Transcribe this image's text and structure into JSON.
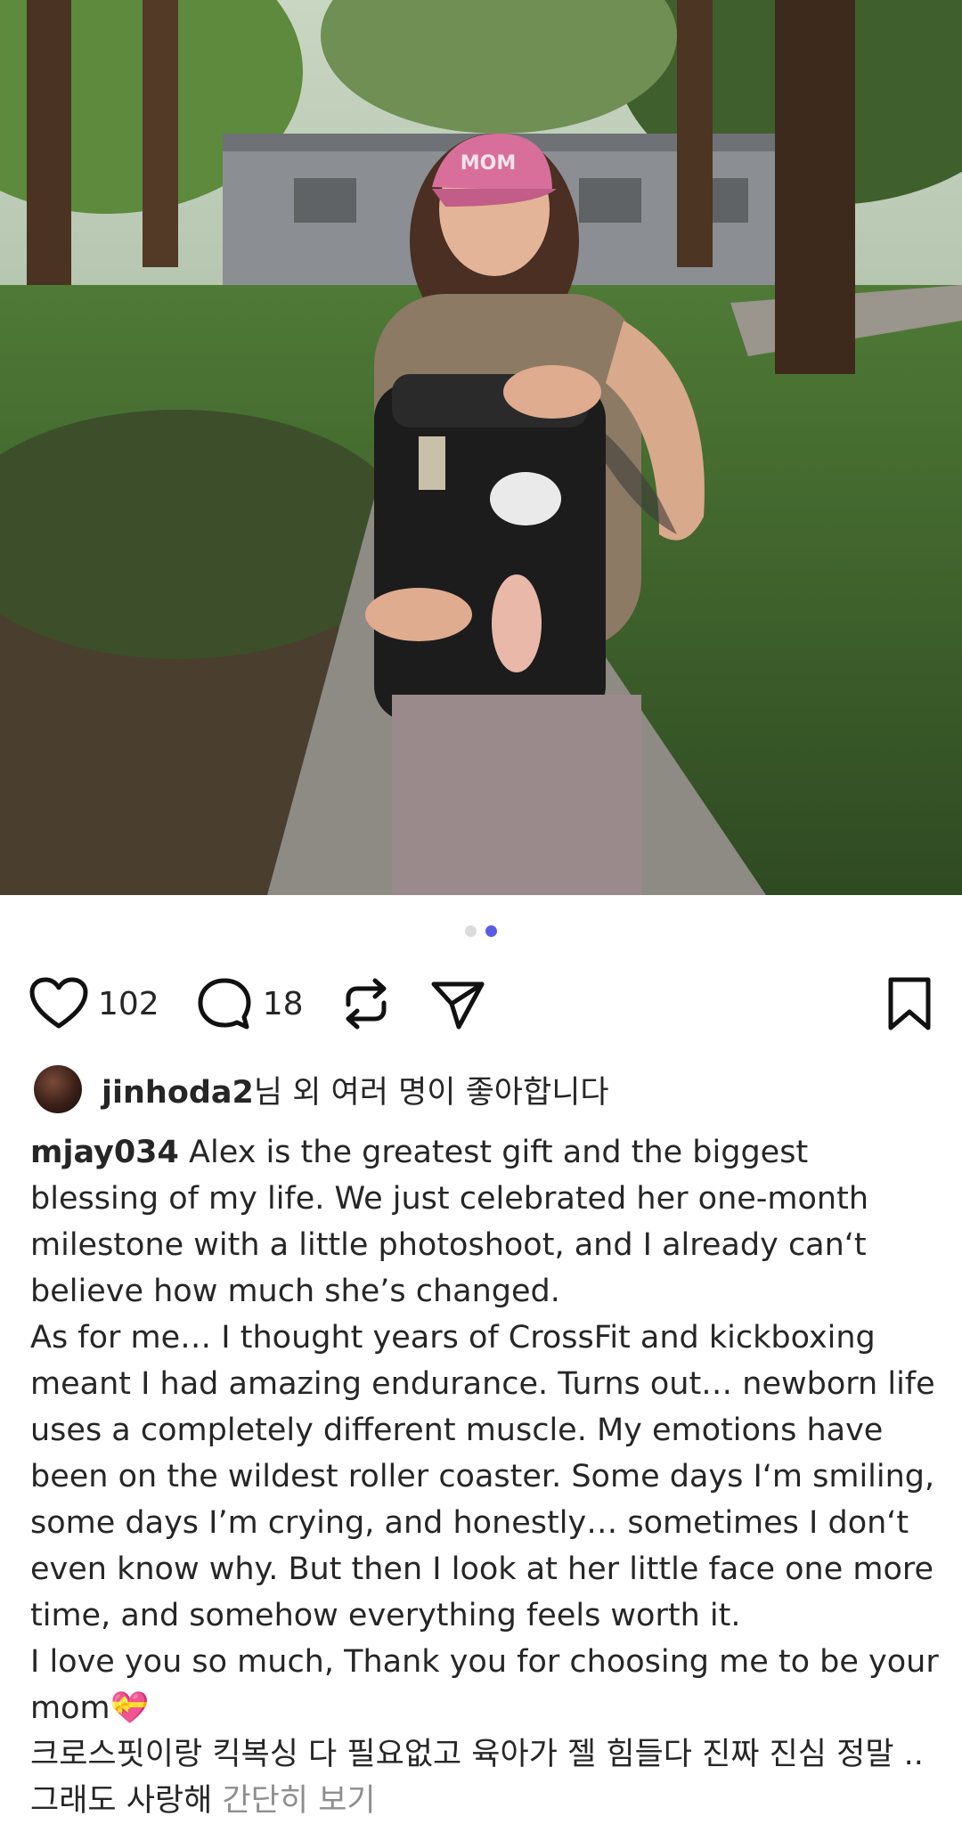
{
  "post": {
    "image_alt": "Smiling woman in pink MOM cap carrying a newborn in a black carrier on a park path",
    "carousel": {
      "count": 2,
      "active": 2
    },
    "colors": {
      "accent": "#5b5ce6",
      "muted": "#8e8e8e",
      "text": "#262626"
    }
  },
  "actions": {
    "like_icon": "heart-icon",
    "like_count": "102",
    "comment_icon": "comment-bubble-icon",
    "comment_count": "18",
    "repost_icon": "repost-icon",
    "share_icon": "send-icon",
    "save_icon": "bookmark-icon"
  },
  "likes": {
    "user": "jinhoda2",
    "suffix": "님 외 여러 명이 좋아합니다"
  },
  "caption": {
    "username": "mjay034",
    "text_lines": [
      "Alex is the greatest gift and the biggest blessing of my life. We just celebrated her one-month milestone with a little photoshoot, and I already can‘t believe how much she’s changed.",
      "As for me… I thought years of CrossFit and kickboxing meant I had amazing endurance. Turns out… newborn life uses a completely different muscle. My emotions have been on the wildest roller coaster. Some days I‘m smiling, some days I’m crying, and honestly… sometimes I don‘t even know why. But then I look at her little face one more time, and somehow everything feels worth it.",
      "I love you so much, Thank you for choosing me to be your mom💝",
      "크로스핏이랑 킥복싱 다 필요없고 육아가 젤 힘들다 진짜 진심 정말 .. 그래도 사랑해"
    ],
    "see_less": "간단히 보기"
  }
}
